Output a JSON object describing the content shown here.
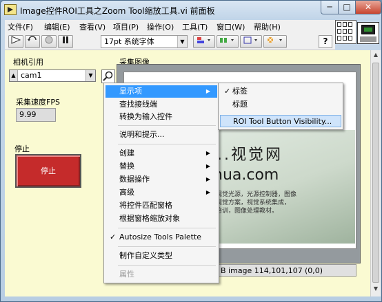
{
  "window": {
    "title": "Image控件ROI工具之Zoom Tool缩放工具.vi 前面板",
    "controls": {
      "minimize": "─",
      "maximize": "□",
      "close": "✕"
    }
  },
  "menubar": {
    "items": [
      "文件(F)",
      "编辑(E)",
      "查看(V)",
      "项目(P)",
      "操作(O)",
      "工具(T)",
      "窗口(W)",
      "帮助(H)"
    ]
  },
  "toolbar": {
    "font": "17pt 系统字体",
    "help": "?",
    "icons": [
      "run-arrow-icon",
      "run-continuous-icon",
      "abort-icon",
      "pause-icon",
      "align-icon",
      "distribute-icon",
      "resize-icon",
      "reorder-icon"
    ]
  },
  "panel": {
    "camera_label": "相机引用",
    "camera_value": "cam1",
    "fps_label": "采集速度FPS",
    "fps_value": "9.99",
    "stop_label": "停止",
    "stop_button": "停止",
    "image_label": "采集图像",
    "image_text_big": "...视觉网",
    "image_text_url": "hua.com",
    "image_text_desc": [
      "视觉光源，光源控制器，图像",
      "视觉方案，视觉系统集成，",
      "培训，图像处理教材。"
    ],
    "image_info": "B image 114,101,107",
    "image_coords": "(0,0)"
  },
  "context_menu": {
    "items": [
      {
        "label": "显示项",
        "submenu": true,
        "highlight": true
      },
      {
        "label": "查找接线端"
      },
      {
        "label": "转换为输入控件"
      },
      {
        "separator": true
      },
      {
        "label": "说明和提示..."
      },
      {
        "separator": true
      },
      {
        "label": "创建",
        "submenu": true
      },
      {
        "label": "替换",
        "submenu": true
      },
      {
        "label": "数据操作",
        "submenu": true
      },
      {
        "label": "高级",
        "submenu": true
      },
      {
        "label": "将控件匹配窗格"
      },
      {
        "label": "根据窗格缩放对象"
      },
      {
        "separator": true
      },
      {
        "label": "Autosize Tools Palette",
        "checked": true
      },
      {
        "separator": true
      },
      {
        "label": "制作自定义类型"
      },
      {
        "separator": true
      },
      {
        "label": "属性",
        "disabled": true
      }
    ]
  },
  "submenu": {
    "items": [
      {
        "label": "标签",
        "checked": true
      },
      {
        "label": "标题"
      },
      {
        "label": "ROI Tool Button Visibility...",
        "highlight": true
      }
    ]
  }
}
